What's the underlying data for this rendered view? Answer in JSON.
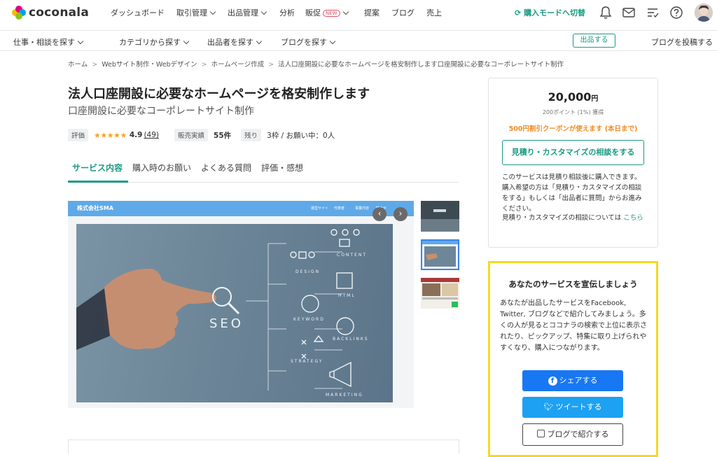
{
  "app": {
    "logo_text": "coconala",
    "nav": {
      "dashboard": "ダッシュボード",
      "transactions": "取引管理",
      "listings": "出品管理",
      "analytics": "分析",
      "promotion": "販促",
      "new_badge": "NEW",
      "proposals": "提案",
      "blog": "ブログ",
      "sales": "売上"
    },
    "buyer_mode": "購入モードへ切替"
  },
  "subnav": {
    "work": "仕事・相談を探す",
    "category": "カテゴリから探す",
    "seller": "出品者を探す",
    "blog": "ブログを探す",
    "list_button": "出品する",
    "post_blog": "ブログを投稿する"
  },
  "breadcrumb": [
    "ホーム",
    "Webサイト制作・Webデザイン",
    "ホームページ作成",
    "法人口座開設に必要なホームページを格安制作します口座開設に必要なコーポレートサイト制作"
  ],
  "service": {
    "title": "法人口座開設に必要なホームページを格安制作します",
    "subtitle": "口座開設に必要なコーポレートサイト制作",
    "rating_label": "評価",
    "stars": "★★★★★",
    "rating": "4.9",
    "reviews": "(49)",
    "sales_label": "販売実績",
    "sales_value": "55件",
    "remaining_label": "残り",
    "remaining_value": "3枠 / お願い中：0人"
  },
  "tabs": [
    "サービス内容",
    "購入時のお願い",
    "よくある質問",
    "評価・感想"
  ],
  "gallery": {
    "site_name": "株式会社SMA",
    "site_nav": [
      "運営サイト",
      "代表者",
      "事業内容",
      "問合せ"
    ],
    "hero_labels": {
      "seo": "SEO",
      "content": "CONTENT",
      "design": "DESIGN",
      "html": "HTML",
      "keyword": "KEYWORD",
      "backlinks": "BACKLINKS",
      "strategy": "STRATEGY",
      "marketing": "MARKETING"
    }
  },
  "purchase": {
    "price": "20,000",
    "currency": "円",
    "points": "200ポイント (1%) 獲得",
    "coupon": "500円割引クーポンが使えます (本日まで)",
    "estimate_button": "見積り・カスタマイズの相談をする",
    "note": "このサービスは見積り相談後に購入できます。購入希望の方は「見積り・カスタマイズの相談をする」もしくは「出品者に質問」からお進みください。",
    "note2_prefix": "見積り・カスタマイズの相談については",
    "note2_link": "こちら"
  },
  "promo": {
    "title": "あなたのサービスを宣伝しましょう",
    "text": "あなたが出品したサービスをFacebook, Twitter, ブログなどで紹介してみましょう。多くの人が見るとココナラの検索で上位に表示されたり、ピックアップ、特集に取り上げられやすくなり、購入につながります。",
    "facebook": "シェアする",
    "twitter": "ツイートする",
    "blog": "ブログで紹介する"
  },
  "colors": {
    "accent": "#1c9a83",
    "coupon": "#f08c24",
    "star": "#f5a623",
    "promo_border": "#f6d820",
    "facebook": "#1877f2",
    "twitter": "#1da1f2"
  }
}
